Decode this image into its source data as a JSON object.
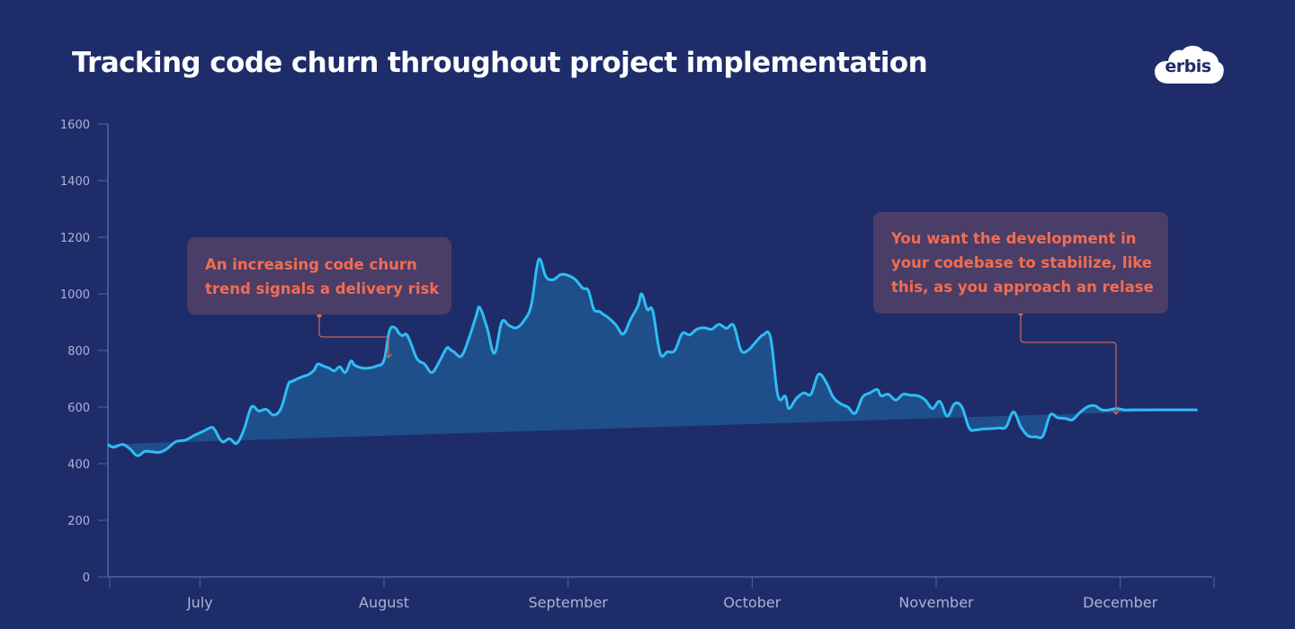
{
  "title": "Tracking code churn throughout project implementation",
  "logo": {
    "text": "erbis",
    "icon": "cloud-icon"
  },
  "colors": {
    "background": "#1e2d69",
    "line": "#2ebdf5",
    "area": "#1f4f8a",
    "axis": "#4f65ad",
    "callout_bg": "#4a3d68",
    "callout_text": "#f26d50",
    "connector": "#c0655a"
  },
  "callouts": [
    {
      "lines": [
        "An increasing code churn",
        "trend signals a delivery risk"
      ]
    },
    {
      "lines": [
        "You want the development in",
        "your codebase to stabilize, like",
        "this, as you approach an relase"
      ]
    }
  ],
  "chart_data": {
    "type": "area",
    "title": "Tracking code churn throughout project implementation",
    "xlabel": "",
    "ylabel": "",
    "ylim": [
      0,
      1600
    ],
    "yticks": [
      0,
      200,
      400,
      600,
      800,
      1000,
      1200,
      1400,
      1600
    ],
    "ytick_labels": [
      "0",
      "200",
      "400",
      "600",
      "800",
      "1000",
      "1200",
      "1400",
      "1600"
    ],
    "xtick_labels": [
      "July",
      "August",
      "September",
      "October",
      "November",
      "December"
    ],
    "xtick_positions": [
      0.5,
      1.5,
      2.5,
      3.5,
      4.5,
      5.5
    ],
    "xlim": [
      0,
      6
    ],
    "grid": false,
    "legend": "none",
    "series": [
      {
        "name": "Code churn",
        "x": [
          0,
          0.03,
          0.08,
          0.12,
          0.16,
          0.2,
          0.24,
          0.28,
          0.32,
          0.37,
          0.42,
          0.47,
          0.52,
          0.56,
          0.58,
          0.62,
          0.66,
          0.7,
          0.74,
          0.78,
          0.82,
          0.86,
          0.9,
          0.94,
          0.98,
          1.0,
          1.03,
          1.06,
          1.09,
          1.12,
          1.14,
          1.17,
          1.2,
          1.23,
          1.26,
          1.29,
          1.32,
          1.34,
          1.38,
          1.42,
          1.46,
          1.5,
          1.53,
          1.56,
          1.58,
          1.6,
          1.62,
          1.64,
          1.68,
          1.72,
          1.76,
          1.8,
          1.84,
          1.86,
          1.88,
          1.92,
          1.96,
          2.0,
          2.02,
          2.06,
          2.1,
          2.14,
          2.18,
          2.22,
          2.26,
          2.3,
          2.34,
          2.38,
          2.42,
          2.46,
          2.5,
          2.54,
          2.58,
          2.61,
          2.64,
          2.67,
          2.69,
          2.72,
          2.76,
          2.8,
          2.84,
          2.88,
          2.9,
          2.93,
          2.96,
          3.0,
          3.04,
          3.08,
          3.12,
          3.16,
          3.2,
          3.24,
          3.28,
          3.32,
          3.36,
          3.4,
          3.44,
          3.48,
          3.52,
          3.56,
          3.6,
          3.64,
          3.68,
          3.7,
          3.74,
          3.78,
          3.82,
          3.86,
          3.9,
          3.94,
          3.98,
          4.02,
          4.06,
          4.1,
          4.14,
          4.18,
          4.2,
          4.24,
          4.28,
          4.32,
          4.36,
          4.4,
          4.44,
          4.48,
          4.52,
          4.56,
          4.6,
          4.64,
          4.68,
          4.72,
          4.76,
          4.8,
          4.84,
          4.88,
          4.92,
          4.96,
          5.0,
          5.04,
          5.08,
          5.12,
          5.16,
          5.2,
          5.24,
          5.28,
          5.32,
          5.36,
          5.4,
          5.44,
          5.48,
          5.52,
          5.56,
          5.6,
          5.64,
          5.68,
          5.72,
          5.76,
          5.8,
          5.84,
          5.88,
          5.92,
          5.96,
          6.0
        ],
        "values": [
          468,
          458,
          468,
          452,
          428,
          443,
          442,
          440,
          452,
          478,
          483,
          500,
          515,
          528,
          520,
          478,
          488,
          472,
          522,
          600,
          586,
          592,
          572,
          595,
          680,
          690,
          700,
          708,
          715,
          730,
          752,
          745,
          738,
          728,
          742,
          722,
          762,
          748,
          738,
          738,
          745,
          765,
          870,
          880,
          862,
          852,
          858,
          835,
          770,
          752,
          722,
          760,
          808,
          803,
          795,
          780,
          840,
          920,
          952,
          880,
          790,
          900,
          888,
          880,
          905,
          960,
          1120,
          1060,
          1050,
          1068,
          1065,
          1050,
          1020,
          1012,
          945,
          938,
          928,
          915,
          890,
          858,
          910,
          958,
          1000,
          945,
          940,
          790,
          795,
          800,
          860,
          855,
          875,
          880,
          875,
          892,
          878,
          888,
          800,
          802,
          830,
          855,
          845,
          640,
          638,
          595,
          630,
          650,
          646,
          715,
          690,
          636,
          612,
          600,
          578,
          635,
          650,
          662,
          640,
          645,
          625,
          645,
          642,
          640,
          625,
          595,
          620,
          568,
          612,
          600,
          525,
          520,
          523,
          524,
          526,
          530,
          583,
          530,
          498,
          495,
          498,
          572,
          562,
          560,
          555,
          580,
          600,
          605,
          590,
          590,
          595,
          590,
          590,
          590,
          590,
          590,
          590,
          590,
          590,
          590,
          590,
          590,
          590
        ]
      }
    ],
    "annotations": [
      {
        "text": "An increasing code churn trend signals a delivery risk",
        "points_to_x": 1.0
      },
      {
        "text": "You want the development in your codebase to stabilize, like this, as you approach an relase",
        "points_to_x": 5.5
      }
    ]
  }
}
